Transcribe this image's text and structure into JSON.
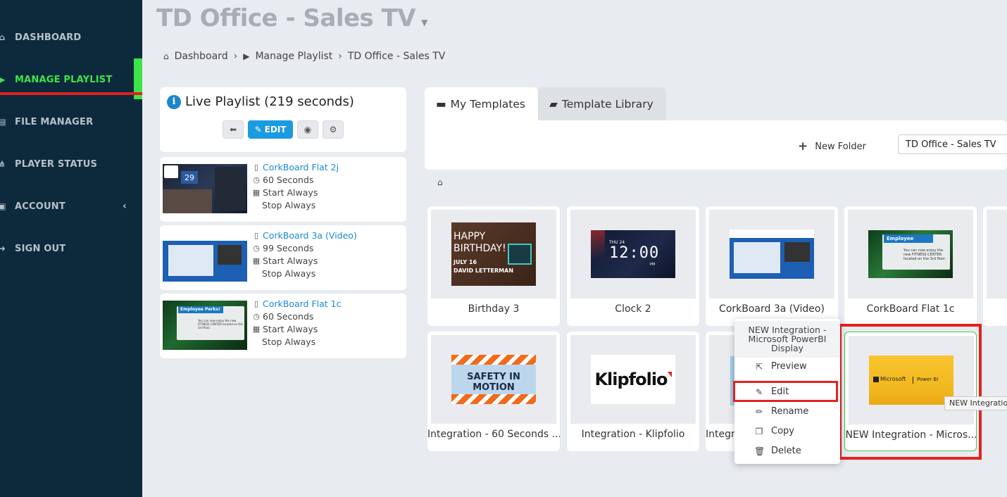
{
  "sidebar": {
    "items": [
      {
        "label": "DASHBOARD",
        "icon": "home-icon"
      },
      {
        "label": "MANAGE PLAYLIST",
        "icon": "playlist-icon"
      },
      {
        "label": "FILE MANAGER",
        "icon": "file-icon"
      },
      {
        "label": "PLAYER STATUS",
        "icon": "network-icon"
      },
      {
        "label": "ACCOUNT",
        "icon": "user-icon"
      },
      {
        "label": "SIGN OUT",
        "icon": "signout-icon"
      }
    ],
    "active_color": "#3ee34a"
  },
  "header": {
    "title": "TD Office - Sales TV",
    "breadcrumb": [
      "Dashboard",
      "Manage Playlist",
      "TD Office - Sales TV"
    ]
  },
  "live_playlist": {
    "title": "Live Playlist (219 seconds)",
    "edit_label": "EDIT",
    "items": [
      {
        "name": "CorkBoard Flat 2j",
        "duration": "60 Seconds",
        "start": "Start Always",
        "stop": "Stop Always",
        "thumb_day": "29"
      },
      {
        "name": "CorkBoard 3a (Video)",
        "duration": "99 Seconds",
        "start": "Start Always",
        "stop": "Stop Always"
      },
      {
        "name": "CorkBoard Flat 1c",
        "duration": "60 Seconds",
        "start": "Start Always",
        "stop": "Stop Always",
        "thumb_heading": "Employee Perks!",
        "thumb_text": "You can now enjoy the new FITNESS CENTER located on the 3rd floor."
      }
    ]
  },
  "templates": {
    "tabs": [
      "My Templates",
      "Template Library"
    ],
    "new_folder_label": "New Folder",
    "folder_select_value": "TD Office - Sales TV",
    "tiles": [
      {
        "label": "Birthday 3",
        "art_lines": [
          "HAPPY",
          "BIRTHDAY!",
          "JULY 16",
          "DAVID LETTERMAN"
        ]
      },
      {
        "label": "Clock 2",
        "art_day": "THU 24",
        "art_time": "12:00",
        "art_ampm": "PM"
      },
      {
        "label": "CorkBoard 3a (Video)"
      },
      {
        "label": "CorkBoard Flat 1c",
        "art_heading": "Employee Perks!",
        "art_text": "You can now enjoy the new FITNESS CENTER located on the 3rd floor."
      },
      {
        "label": "Integration - 60 Seconds ...",
        "art_text": "SAFETY IN MOTION"
      },
      {
        "label": "Integration - Klipfolio",
        "art_text": "Klipfolio"
      },
      {
        "label": "Integr"
      },
      {
        "label": "NEW Integration - Micros...",
        "art_brand": "Microsoft",
        "art_product": "Power BI"
      }
    ]
  },
  "context_menu": {
    "title": "NEW Integration - Microsoft PowerBI Display",
    "items": [
      "Preview",
      "Edit",
      "Rename",
      "Copy",
      "Delete"
    ]
  },
  "tooltip": "NEW Integration",
  "colors": {
    "sidebar_bg": "#0c2a3c",
    "primary": "#1a9be0",
    "highlight_red": "#e3231f"
  }
}
